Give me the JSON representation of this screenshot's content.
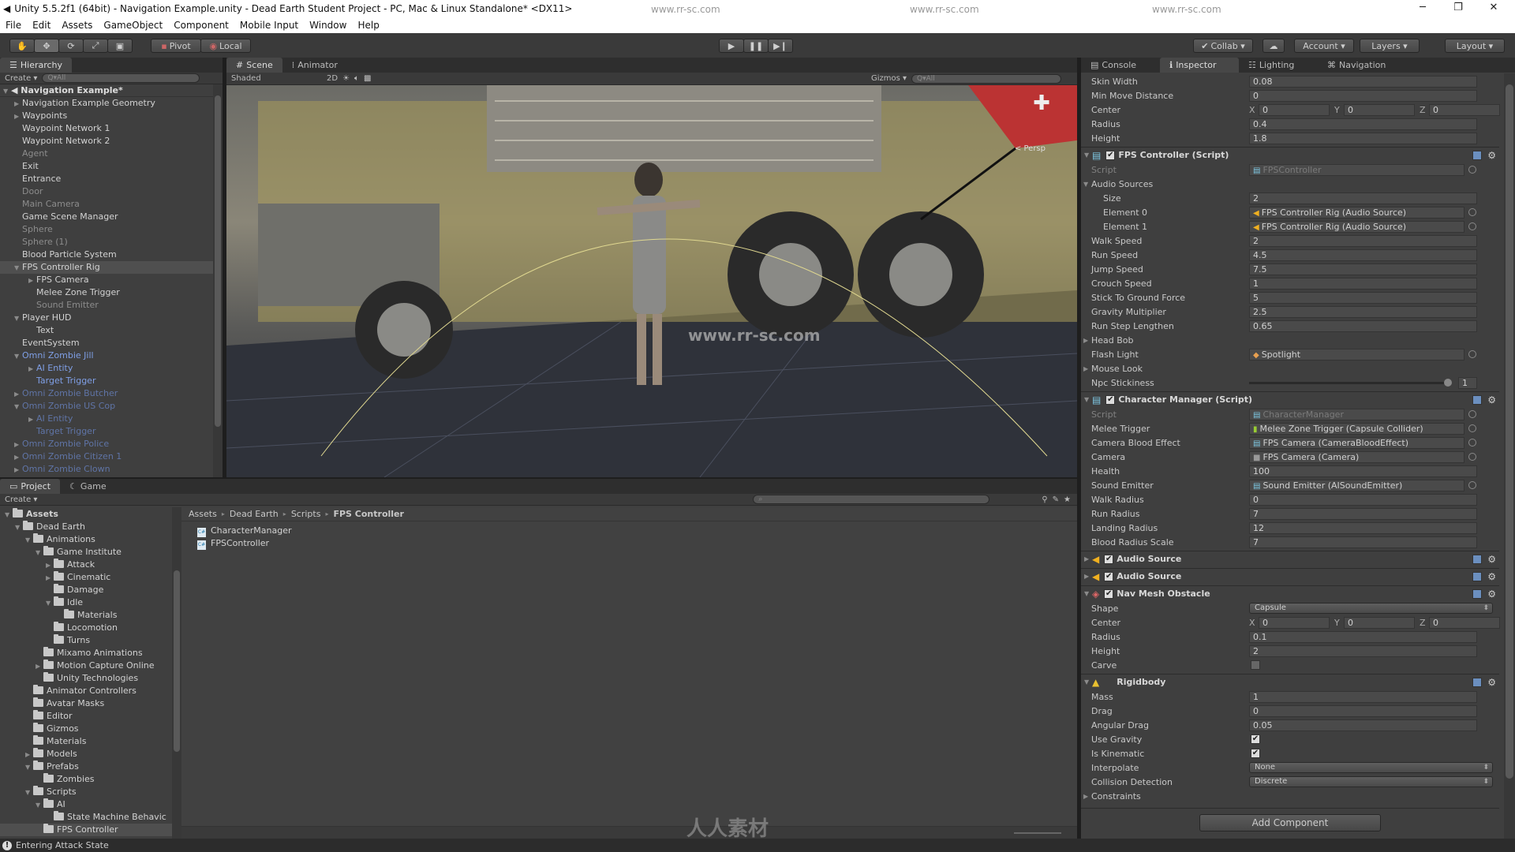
{
  "window": {
    "title": "Unity 5.5.2f1 (64bit) - Navigation Example.unity - Dead Earth Student Project - PC, Mac & Linux Standalone* <DX11>",
    "minimize": "─",
    "maximize": "❐",
    "close": "✕"
  },
  "menu": [
    "File",
    "Edit",
    "Assets",
    "GameObject",
    "Component",
    "Mobile Input",
    "Window",
    "Help"
  ],
  "toolbar": {
    "pivot": "Pivot",
    "local": "Local",
    "collab": "Collab ▾",
    "account": "Account ▾",
    "layers": "Layers ▾",
    "layout": "Layout ▾",
    "tools": [
      "hand-icon",
      "move-icon",
      "rotate-icon",
      "scale-icon",
      "rect-icon"
    ]
  },
  "hierarchy": {
    "tab": "Hierarchy",
    "create": "Create ▾",
    "search_placeholder": "Q▾All",
    "scene": "Navigation Example*",
    "items": [
      {
        "label": "Navigation Example Geometry",
        "level": 1,
        "arrow": "right",
        "style": "normal"
      },
      {
        "label": "Waypoints",
        "level": 1,
        "arrow": "right",
        "style": "normal"
      },
      {
        "label": "Waypoint Network 1",
        "level": 1,
        "style": "normal"
      },
      {
        "label": "Waypoint Network 2",
        "level": 1,
        "style": "normal"
      },
      {
        "label": "Agent",
        "level": 1,
        "style": "dim"
      },
      {
        "label": "Exit",
        "level": 1,
        "style": "normal"
      },
      {
        "label": "Entrance",
        "level": 1,
        "style": "normal"
      },
      {
        "label": "Door",
        "level": 1,
        "style": "dim"
      },
      {
        "label": "Main Camera",
        "level": 1,
        "style": "dim"
      },
      {
        "label": "Game Scene Manager",
        "level": 1,
        "style": "normal"
      },
      {
        "label": "Sphere",
        "level": 1,
        "style": "dim"
      },
      {
        "label": "Sphere (1)",
        "level": 1,
        "style": "dim"
      },
      {
        "label": "Blood Particle System",
        "level": 1,
        "style": "normal"
      },
      {
        "label": "FPS Controller Rig",
        "level": 1,
        "arrow": "down",
        "style": "normal",
        "selected": true
      },
      {
        "label": "FPS Camera",
        "level": 2,
        "arrow": "right",
        "style": "normal"
      },
      {
        "label": "Melee Zone Trigger",
        "level": 2,
        "style": "normal"
      },
      {
        "label": "Sound Emitter",
        "level": 2,
        "style": "dim"
      },
      {
        "label": "Player HUD",
        "level": 1,
        "arrow": "down",
        "style": "normal"
      },
      {
        "label": "Text",
        "level": 2,
        "style": "normal"
      },
      {
        "label": "EventSystem",
        "level": 1,
        "style": "normal"
      },
      {
        "label": "Omni Zombie Jill",
        "level": 1,
        "arrow": "down",
        "style": "prefab"
      },
      {
        "label": "AI Entity",
        "level": 2,
        "arrow": "right",
        "style": "prefab"
      },
      {
        "label": "Target Trigger",
        "level": 2,
        "style": "prefab"
      },
      {
        "label": "Omni Zombie Butcher",
        "level": 1,
        "arrow": "right",
        "style": "prefabdim"
      },
      {
        "label": "Omni Zombie US Cop",
        "level": 1,
        "arrow": "down",
        "style": "prefabdim"
      },
      {
        "label": "AI Entity",
        "level": 2,
        "arrow": "right",
        "style": "prefabdim"
      },
      {
        "label": "Target Trigger",
        "level": 2,
        "style": "prefabdim"
      },
      {
        "label": "Omni Zombie Police",
        "level": 1,
        "arrow": "right",
        "style": "prefabdim"
      },
      {
        "label": "Omni Zombie Citizen 1",
        "level": 1,
        "arrow": "right",
        "style": "prefabdim"
      },
      {
        "label": "Omni Zombie Clown",
        "level": 1,
        "arrow": "right",
        "style": "prefabdim"
      }
    ]
  },
  "scene": {
    "tabs": [
      "Scene",
      "Animator"
    ],
    "shading": "Shaded",
    "mode_2d": "2D",
    "gizmos": "Gizmos ▾",
    "search_placeholder": "Q▾All",
    "persp": "< Persp"
  },
  "project": {
    "tabs": [
      "Project",
      "Game"
    ],
    "create": "Create ▾",
    "tree": [
      {
        "label": "Assets",
        "level": 0,
        "arrow": "down",
        "bold": true
      },
      {
        "label": "Dead Earth",
        "level": 1,
        "arrow": "down"
      },
      {
        "label": "Animations",
        "level": 2,
        "arrow": "down"
      },
      {
        "label": "Game Institute",
        "level": 3,
        "arrow": "down"
      },
      {
        "label": "Attack",
        "level": 4,
        "arrow": "right"
      },
      {
        "label": "Cinematic",
        "level": 4,
        "arrow": "right"
      },
      {
        "label": "Damage",
        "level": 4
      },
      {
        "label": "Idle",
        "level": 4,
        "arrow": "down"
      },
      {
        "label": "Materials",
        "level": 5
      },
      {
        "label": "Locomotion",
        "level": 4
      },
      {
        "label": "Turns",
        "level": 4
      },
      {
        "label": "Mixamo Animations",
        "level": 3
      },
      {
        "label": "Motion Capture Online",
        "level": 3,
        "arrow": "right"
      },
      {
        "label": "Unity Technologies",
        "level": 3
      },
      {
        "label": "Animator Controllers",
        "level": 2
      },
      {
        "label": "Avatar Masks",
        "level": 2
      },
      {
        "label": "Editor",
        "level": 2
      },
      {
        "label": "Gizmos",
        "level": 2
      },
      {
        "label": "Materials",
        "level": 2
      },
      {
        "label": "Models",
        "level": 2,
        "arrow": "right"
      },
      {
        "label": "Prefabs",
        "level": 2,
        "arrow": "down"
      },
      {
        "label": "Zombies",
        "level": 3
      },
      {
        "label": "Scripts",
        "level": 2,
        "arrow": "down"
      },
      {
        "label": "AI",
        "level": 3,
        "arrow": "down"
      },
      {
        "label": "State Machine Behavic",
        "level": 4
      },
      {
        "label": "FPS Controller",
        "level": 3,
        "selected": true
      }
    ],
    "breadcrumb": [
      "Assets",
      "Dead Earth",
      "Scripts",
      "FPS Controller"
    ],
    "files": [
      "CharacterManager",
      "FPSController"
    ]
  },
  "status": {
    "message": "Entering Attack State"
  },
  "inspector": {
    "tabs": [
      "Console",
      "Inspector",
      "Lighting",
      "Navigation"
    ],
    "rows": [
      {
        "kind": "field",
        "label": "Skin Width",
        "value": "0.08"
      },
      {
        "kind": "field",
        "label": "Min Move Distance",
        "value": "0"
      },
      {
        "kind": "vec3",
        "label": "Center",
        "x": "0",
        "y": "0",
        "z": "0"
      },
      {
        "kind": "field",
        "label": "Radius",
        "value": "0.4"
      },
      {
        "kind": "field",
        "label": "Height",
        "value": "1.8"
      },
      {
        "kind": "header",
        "label": "FPS Controller (Script)",
        "icon": "script-icon",
        "checked": true,
        "expanded": true
      },
      {
        "kind": "obj",
        "label": "Script",
        "value": "FPSController",
        "disabled": true
      },
      {
        "kind": "foldout",
        "label": "Audio Sources",
        "expanded": true
      },
      {
        "kind": "field",
        "label": "Size",
        "value": "2",
        "indent": true
      },
      {
        "kind": "obj",
        "label": "Element 0",
        "value": "FPS Controller Rig (Audio Source)",
        "indent": true,
        "icon": "audio-source-icon"
      },
      {
        "kind": "obj",
        "label": "Element 1",
        "value": "FPS Controller Rig (Audio Source)",
        "indent": true,
        "icon": "audio-source-icon"
      },
      {
        "kind": "field",
        "label": "Walk Speed",
        "value": "2"
      },
      {
        "kind": "field",
        "label": "Run Speed",
        "value": "4.5"
      },
      {
        "kind": "field",
        "label": "Jump Speed",
        "value": "7.5"
      },
      {
        "kind": "field",
        "label": "Crouch Speed",
        "value": "1"
      },
      {
        "kind": "field",
        "label": "Stick To Ground Force",
        "value": "5"
      },
      {
        "kind": "field",
        "label": "Gravity Multiplier",
        "value": "2.5"
      },
      {
        "kind": "field",
        "label": "Run Step Lengthen",
        "value": "0.65"
      },
      {
        "kind": "foldout",
        "label": "Head Bob",
        "expanded": false
      },
      {
        "kind": "obj",
        "label": "Flash Light",
        "value": "Spotlight",
        "icon": "light-icon"
      },
      {
        "kind": "foldout",
        "label": "Mouse Look",
        "expanded": false
      },
      {
        "kind": "slider",
        "label": "Npc Stickiness",
        "value": "1",
        "fraction": 1.0
      },
      {
        "kind": "header",
        "label": "Character Manager (Script)",
        "icon": "script-icon",
        "checked": true,
        "expanded": true
      },
      {
        "kind": "obj",
        "label": "Script",
        "value": "CharacterManager",
        "disabled": true
      },
      {
        "kind": "obj",
        "label": "Melee Trigger",
        "value": "Melee Zone Trigger (Capsule Collider)",
        "icon": "capsule-collider-icon"
      },
      {
        "kind": "obj",
        "label": "Camera Blood Effect",
        "value": "FPS Camera (CameraBloodEffect)",
        "icon": "script-icon"
      },
      {
        "kind": "obj",
        "label": "Camera",
        "value": "FPS Camera (Camera)",
        "icon": "camera-icon"
      },
      {
        "kind": "field",
        "label": "Health",
        "value": "100"
      },
      {
        "kind": "obj",
        "label": "Sound Emitter",
        "value": "Sound Emitter (AISoundEmitter)",
        "icon": "script-icon"
      },
      {
        "kind": "field",
        "label": "Walk Radius",
        "value": "0"
      },
      {
        "kind": "field",
        "label": "Run Radius",
        "value": "7"
      },
      {
        "kind": "field",
        "label": "Landing Radius",
        "value": "12"
      },
      {
        "kind": "field",
        "label": "Blood Radius Scale",
        "value": "7"
      },
      {
        "kind": "header",
        "label": "Audio Source",
        "icon": "audio-source-icon",
        "checked": true,
        "expanded": false
      },
      {
        "kind": "header",
        "label": "Audio Source",
        "icon": "audio-source-icon",
        "checked": true,
        "expanded": false
      },
      {
        "kind": "header",
        "label": "Nav Mesh Obstacle",
        "icon": "nav-mesh-obstacle-icon",
        "checked": true,
        "expanded": true
      },
      {
        "kind": "dropdown",
        "label": "Shape",
        "value": "Capsule"
      },
      {
        "kind": "vec3",
        "label": "Center",
        "x": "0",
        "y": "0",
        "z": "0"
      },
      {
        "kind": "field",
        "label": "Radius",
        "value": "0.1"
      },
      {
        "kind": "field",
        "label": "Height",
        "value": "2"
      },
      {
        "kind": "check",
        "label": "Carve",
        "checked": false
      },
      {
        "kind": "header",
        "label": "Rigidbody",
        "icon": "rigidbody-icon",
        "expanded": true
      },
      {
        "kind": "field",
        "label": "Mass",
        "value": "1"
      },
      {
        "kind": "field",
        "label": "Drag",
        "value": "0"
      },
      {
        "kind": "field",
        "label": "Angular Drag",
        "value": "0.05"
      },
      {
        "kind": "check",
        "label": "Use Gravity",
        "checked": true
      },
      {
        "kind": "check",
        "label": "Is Kinematic",
        "checked": true
      },
      {
        "kind": "dropdown",
        "label": "Interpolate",
        "value": "None"
      },
      {
        "kind": "dropdown",
        "label": "Collision Detection",
        "value": "Discrete"
      },
      {
        "kind": "foldout",
        "label": "Constraints",
        "expanded": false
      }
    ],
    "add_component": "Add Component"
  },
  "watermarks": [
    "www.rr-sc.com",
    "www.rr-sc.com",
    "www.rr-sc.com",
    "www.rr-sc.com",
    "人人素材"
  ],
  "colors": {
    "prefab": "#7f9fe6",
    "selection": "#4f4f4f",
    "panel": "#3f3f3f"
  }
}
